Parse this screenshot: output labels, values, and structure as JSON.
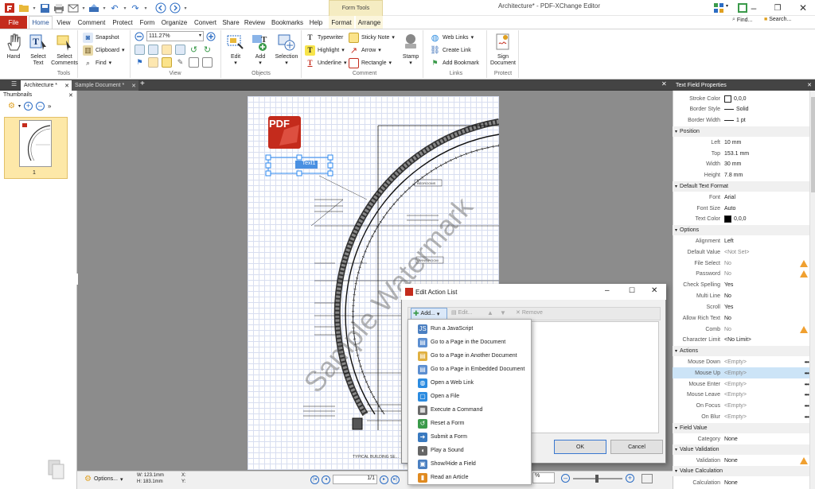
{
  "window": {
    "title": "Architecture* - PDF-XChange Editor",
    "context_tab_group": "Form Tools"
  },
  "menu": {
    "file": "File",
    "tabs": [
      "Home",
      "View",
      "Comment",
      "Protect",
      "Form",
      "Organize",
      "Convert",
      "Share",
      "Review",
      "Bookmarks",
      "Help"
    ],
    "context_tabs": [
      "Format",
      "Arrange"
    ],
    "find": "Find...",
    "search": "Search..."
  },
  "ribbon": {
    "tools": {
      "label": "Tools",
      "hand": "Hand",
      "select_text": "Select Text",
      "select_comments": "Select Comments"
    },
    "snapshot": "Snapshot",
    "clipboard": "Clipboard",
    "find": "Find",
    "view": {
      "label": "View",
      "zoom": "111.27%"
    },
    "objects": {
      "label": "Objects",
      "edit": "Edit",
      "add": "Add",
      "selection": "Selection"
    },
    "comment": {
      "label": "Comment",
      "typewriter": "Typewriter",
      "sticky_note": "Sticky Note",
      "highlight": "Highlight",
      "arrow": "Arrow",
      "underline": "Underline",
      "rectangle": "Rectangle",
      "stamp": "Stamp"
    },
    "links": {
      "label": "Links",
      "web_links": "Web Links",
      "create_link": "Create Link",
      "add_bookmark": "Add Bookmark"
    },
    "protect": {
      "label": "Protect",
      "sign_document": "Sign Document"
    }
  },
  "doc_tabs": [
    "Architecture *",
    "Sample Document *"
  ],
  "thumbnails": {
    "title": "Thumbnails",
    "page_label": "1"
  },
  "page": {
    "watermark": "Sample Watermark",
    "field_text": "Text1",
    "bedrooms": "BEDROOMS",
    "living_room": "LIVING ROOM",
    "bottom": "TYPICAL BUILDING SE..."
  },
  "status": {
    "options": "Options...",
    "w": "W: 123.1mm",
    "h": "H: 183.1mm",
    "x": "X:",
    "y": "Y:",
    "page": "1/1",
    "zoom_pct": "%"
  },
  "properties": {
    "title": "Text Field Properties",
    "rows": [
      {
        "type": "row",
        "label": "Stroke Color",
        "value": "0,0,0",
        "swatch": "#ffffff"
      },
      {
        "type": "row",
        "label": "Border Style",
        "value": "Solid",
        "line": true
      },
      {
        "type": "row",
        "label": "Border Width",
        "value": "1 pt",
        "line": true
      },
      {
        "type": "section",
        "label": "Position"
      },
      {
        "type": "row",
        "label": "Left",
        "value": "10 mm"
      },
      {
        "type": "row",
        "label": "Top",
        "value": "153.1 mm"
      },
      {
        "type": "row",
        "label": "Width",
        "value": "30 mm"
      },
      {
        "type": "row",
        "label": "Height",
        "value": "7.8 mm"
      },
      {
        "type": "section",
        "label": "Default Text Format"
      },
      {
        "type": "row",
        "label": "Font",
        "value": "Arial"
      },
      {
        "type": "row",
        "label": "Font Size",
        "value": "Auto"
      },
      {
        "type": "row",
        "label": "Text Color",
        "value": "0,0,0",
        "swatch": "#000000"
      },
      {
        "type": "section",
        "label": "Options"
      },
      {
        "type": "row",
        "label": "Alignment",
        "value": "Left"
      },
      {
        "type": "row",
        "label": "Default Value",
        "value": "<Not Set>",
        "gray": true
      },
      {
        "type": "row",
        "label": "File Select",
        "value": "No",
        "gray": true,
        "warn": true
      },
      {
        "type": "row",
        "label": "Password",
        "value": "No",
        "gray": true,
        "warn": true
      },
      {
        "type": "row",
        "label": "Check Spelling",
        "value": "Yes"
      },
      {
        "type": "row",
        "label": "Multi Line",
        "value": "No"
      },
      {
        "type": "row",
        "label": "Scroll",
        "value": "Yes"
      },
      {
        "type": "row",
        "label": "Allow Rich Text",
        "value": "No"
      },
      {
        "type": "row",
        "label": "Comb",
        "value": "No",
        "gray": true,
        "warn": true
      },
      {
        "type": "row",
        "label": "Character Limit",
        "value": "<No Limit>"
      },
      {
        "type": "section",
        "label": "Actions"
      },
      {
        "type": "row",
        "label": "Mouse Down",
        "value": "<Empty>",
        "gray": true,
        "more": true
      },
      {
        "type": "row",
        "label": "Mouse Up",
        "value": "<Empty>",
        "gray": true,
        "more": true,
        "selected": true
      },
      {
        "type": "row",
        "label": "Mouse Enter",
        "value": "<Empty>",
        "gray": true,
        "more": true
      },
      {
        "type": "row",
        "label": "Mouse Leave",
        "value": "<Empty>",
        "gray": true,
        "more": true
      },
      {
        "type": "row",
        "label": "On Focus",
        "value": "<Empty>",
        "gray": true,
        "more": true
      },
      {
        "type": "row",
        "label": "On Blur",
        "value": "<Empty>",
        "gray": true,
        "more": true
      },
      {
        "type": "section",
        "label": "Field Value"
      },
      {
        "type": "row",
        "label": "Category",
        "value": "None"
      },
      {
        "type": "section",
        "label": "Value Validation"
      },
      {
        "type": "row",
        "label": "Validation",
        "value": "None",
        "warn": true
      },
      {
        "type": "section",
        "label": "Value Calculation"
      },
      {
        "type": "row",
        "label": "Calculation",
        "value": "None"
      }
    ]
  },
  "dialog": {
    "title": "Edit Action List",
    "add": "Add...",
    "edit": "Edit...",
    "remove": "Remove",
    "ok": "OK",
    "cancel": "Cancel",
    "menu_items": [
      {
        "label": "Run a JavaScript",
        "icon": "javascript-icon",
        "color": "#4a7fc1",
        "glyph": "JS"
      },
      {
        "label": "Go to a Page in the Document",
        "icon": "document-page-icon",
        "color": "#5b8ed0",
        "glyph": "▤"
      },
      {
        "label": "Go to a Page in Another Document",
        "icon": "folder-page-icon",
        "color": "#e0b040",
        "glyph": "▤"
      },
      {
        "label": "Go to a Page in Embedded Document",
        "icon": "embedded-page-icon",
        "color": "#5b8ed0",
        "glyph": "▤"
      },
      {
        "label": "Open a Web Link",
        "icon": "globe-icon",
        "color": "#2b8be0",
        "glyph": "◍"
      },
      {
        "label": "Open a File",
        "icon": "open-file-icon",
        "color": "#2b8be0",
        "glyph": "▢"
      },
      {
        "label": "Execute a Command",
        "icon": "command-icon",
        "color": "#6a6a6a",
        "glyph": "▦"
      },
      {
        "label": "Reset a Form",
        "icon": "reset-form-icon",
        "color": "#3a9a4a",
        "glyph": "↺"
      },
      {
        "label": "Submit a Form",
        "icon": "submit-form-icon",
        "color": "#3a7ac0",
        "glyph": "➜"
      },
      {
        "label": "Play a Sound",
        "icon": "speaker-icon",
        "color": "#666666",
        "glyph": "◖"
      },
      {
        "label": "Show/Hide a Field",
        "icon": "show-hide-field-icon",
        "color": "#4a7fc1",
        "glyph": "▣"
      },
      {
        "label": "Read an Article",
        "icon": "article-icon",
        "color": "#e08a20",
        "glyph": "▮"
      }
    ]
  },
  "colors": {
    "file_tab": "#c42b1c",
    "accent": "#2b579a",
    "selection": "#2d89ef"
  }
}
